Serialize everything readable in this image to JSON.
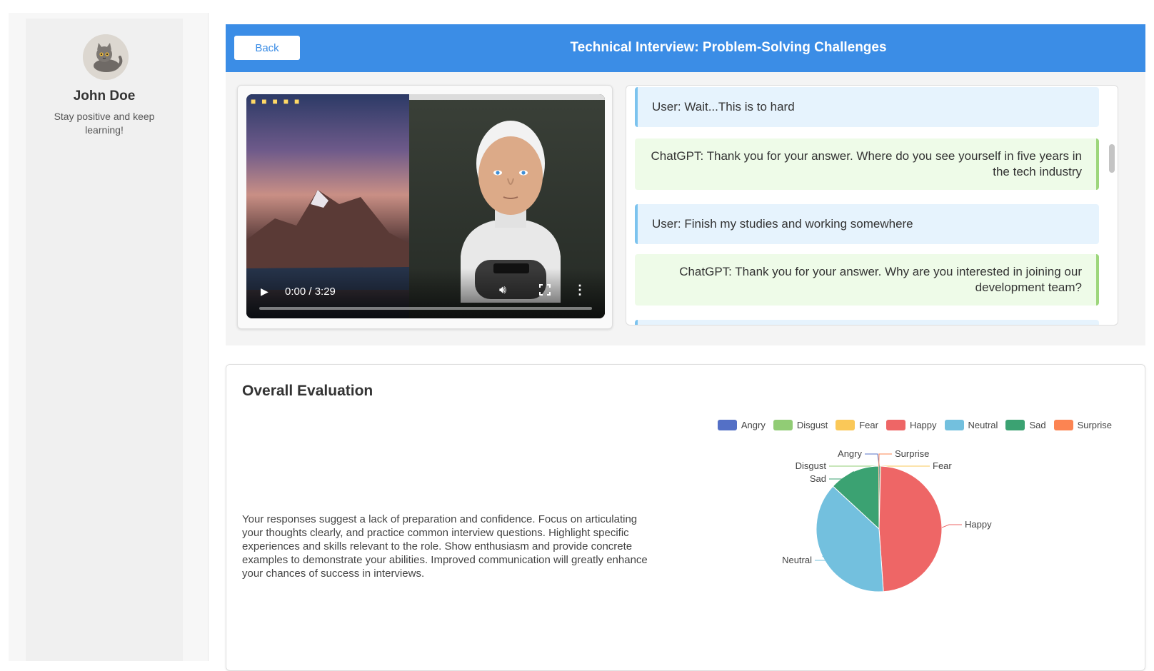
{
  "sidebar": {
    "name": "John Doe",
    "motto": "Stay positive and keep learning!"
  },
  "header": {
    "back_label": "Back",
    "title": "Technical Interview: Problem-Solving Challenges"
  },
  "video": {
    "time": "0:00 / 3:29",
    "progress": 0
  },
  "chat": {
    "messages": [
      {
        "role": "user",
        "text": "User: Wait...This is to hard"
      },
      {
        "role": "bot",
        "text": "ChatGPT: Thank you for your answer. Where do you see yourself in five years in the tech industry"
      },
      {
        "role": "user",
        "text": "User: Finish my studies and working somewhere"
      },
      {
        "role": "bot",
        "text": "ChatGPT: Thank you for your answer. Why are you interested in joining our development team?"
      }
    ]
  },
  "evaluation": {
    "title": "Overall Evaluation",
    "text": "Your responses suggest a lack of preparation and confidence. Focus on articulating your thoughts clearly, and practice common interview questions. Highlight specific experiences and skills relevant to the role. Show enthusiasm and provide concrete examples to demonstrate your abilities. Improved communication will greatly enhance your chances of success in interviews."
  },
  "chart_data": {
    "type": "pie",
    "legend_position": "top-right",
    "slices": [
      {
        "label": "Angry",
        "value": 0.1,
        "color": "#5470c6"
      },
      {
        "label": "Disgust",
        "value": 0.2,
        "color": "#91cc75"
      },
      {
        "label": "Fear",
        "value": 0.1,
        "color": "#fac858"
      },
      {
        "label": "Happy",
        "value": 48.5,
        "color": "#ee6666"
      },
      {
        "label": "Neutral",
        "value": 38.0,
        "color": "#73c0de"
      },
      {
        "label": "Sad",
        "value": 13.0,
        "color": "#3ba272"
      },
      {
        "label": "Surprise",
        "value": 0.1,
        "color": "#fc8452"
      }
    ]
  }
}
